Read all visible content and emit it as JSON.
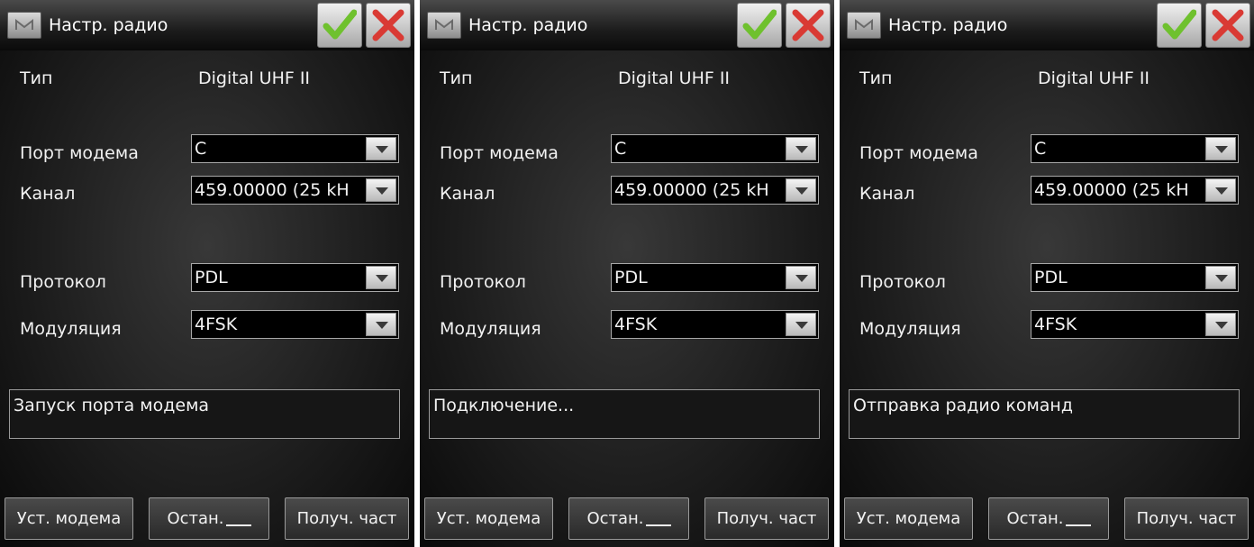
{
  "screen": {
    "title": "Настр. радио",
    "labels": {
      "type": "Тип",
      "port": "Порт модема",
      "channel": "Канал",
      "protocol": "Протокол",
      "modulation": "Модуляция"
    },
    "type_value": "Digital UHF II",
    "port_value": "C",
    "channel_value": "459.00000 (25 kH",
    "protocol_value": "PDL",
    "modulation_value": "4FSK",
    "buttons": {
      "setup_modem": "Уст. модема",
      "stop": "Остан.",
      "get_freq": "Получ. част"
    },
    "icons": {
      "menu": "menu-icon",
      "ok": "checkmark-icon",
      "cancel": "close-icon",
      "dropdown": "chevron-down-icon"
    },
    "colors": {
      "ok_green": "#6fc12e",
      "cancel_red": "#d93a34"
    }
  },
  "panels": [
    {
      "status_text": "Запуск порта модема"
    },
    {
      "status_text": "Подключение..."
    },
    {
      "status_text": "Отправка радио команд"
    }
  ]
}
